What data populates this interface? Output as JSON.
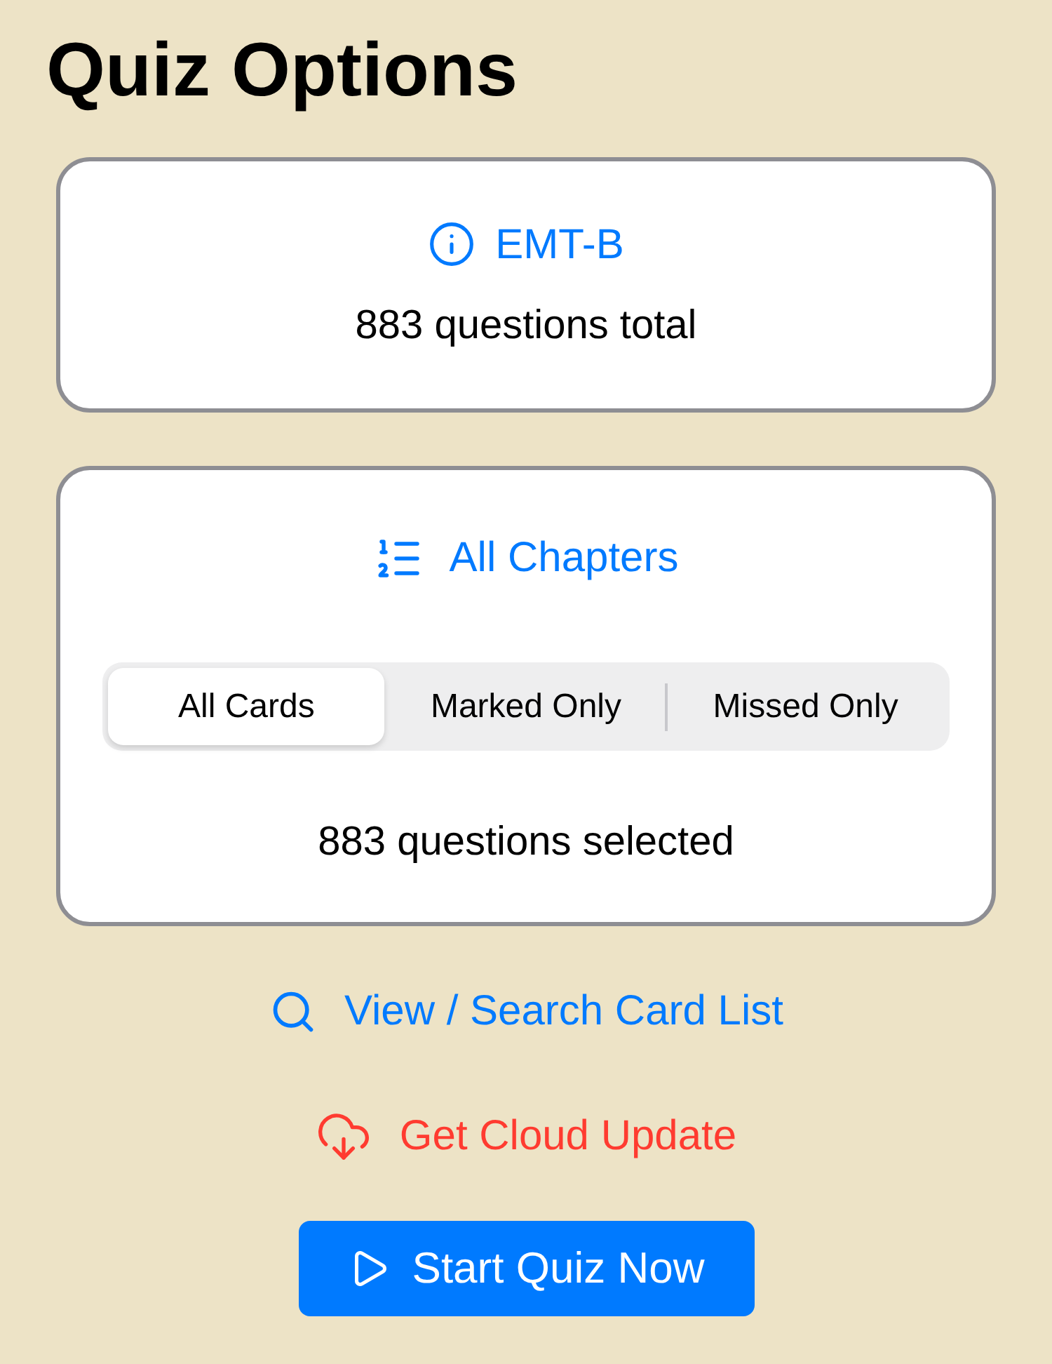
{
  "title": "Quiz Options",
  "deck": {
    "name": "EMT-B",
    "total": "883 questions total"
  },
  "chapters": {
    "label": "All Chapters",
    "segments": [
      {
        "label": "All Cards",
        "selected": true
      },
      {
        "label": "Marked Only",
        "selected": false
      },
      {
        "label": "Missed Only",
        "selected": false
      }
    ],
    "selected_count": "883 questions selected"
  },
  "actions": [
    {
      "kind": "search",
      "label": "View / Search Card List"
    },
    {
      "kind": "cloud",
      "label": "Get Cloud Update"
    }
  ],
  "start_button": "Start Quiz Now"
}
